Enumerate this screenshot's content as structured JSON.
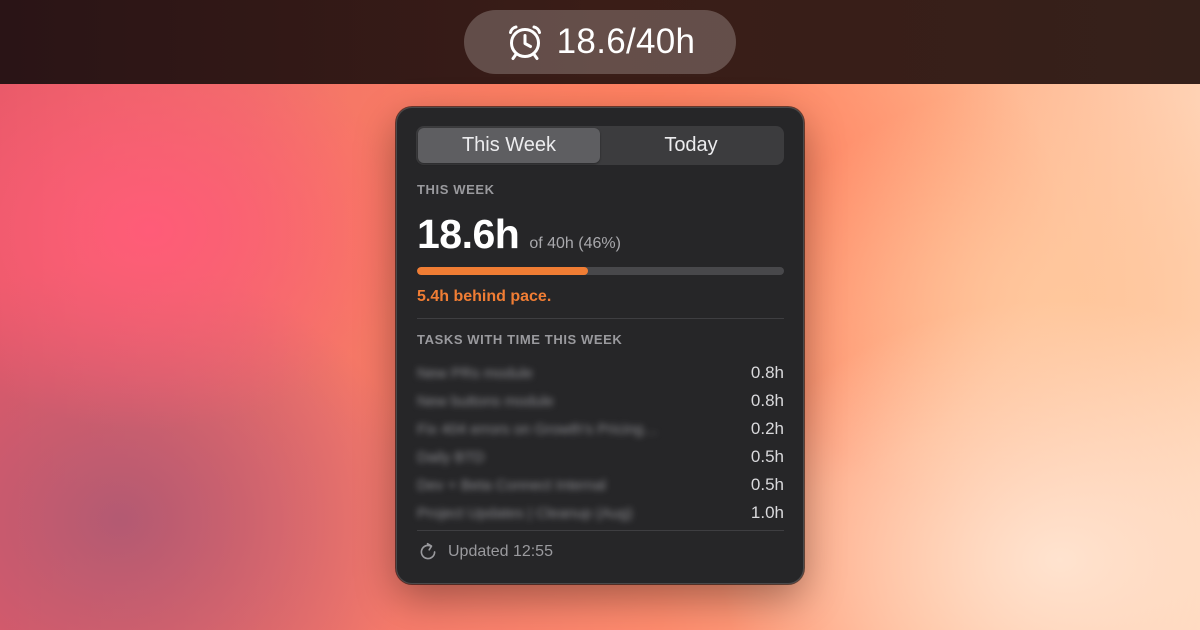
{
  "menubar": {
    "icon": "alarm-clock-icon",
    "status_text": "18.6/40h"
  },
  "popover": {
    "tabs": [
      {
        "label": "This Week",
        "active": true
      },
      {
        "label": "Today",
        "active": false
      }
    ],
    "summary": {
      "section_label": "THIS WEEK",
      "hours_logged": "18.6h",
      "goal_text": "of 40h (46%)",
      "progress_fraction": 0.465,
      "pace_text": "5.4h behind pace."
    },
    "tasks": {
      "section_label": "TASKS WITH TIME THIS WEEK",
      "items": [
        {
          "name": "New PRs module",
          "time": "0.8h"
        },
        {
          "name": "New buttons module",
          "time": "0.8h"
        },
        {
          "name": "Fix 404 errors on Growth's Pricing…",
          "time": "0.2h"
        },
        {
          "name": "Daily BTD",
          "time": "0.5h"
        },
        {
          "name": "Dev + Beta Connect Internal",
          "time": "0.5h"
        },
        {
          "name": "Project Updates | Cleanup (Aug)",
          "time": "1.0h"
        }
      ]
    },
    "footer": {
      "icon": "refresh-icon",
      "updated_text": "Updated 12:55"
    }
  },
  "colors": {
    "accent": "#f07d34",
    "panel_bg": "#262628",
    "menubar_bg": "#2f1918"
  }
}
